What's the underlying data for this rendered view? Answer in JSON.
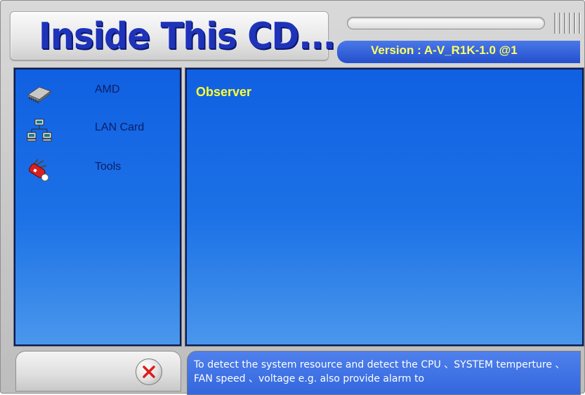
{
  "header": {
    "title": "Inside This CD...",
    "version": "Version : A-V_R1K-1.0 @1"
  },
  "sidebar": {
    "items": [
      {
        "label": "AMD",
        "icon": "chip-icon"
      },
      {
        "label": "LAN Card",
        "icon": "network-icon"
      },
      {
        "label": "Tools",
        "icon": "tools-icon"
      }
    ]
  },
  "main": {
    "title": "Observer"
  },
  "footer": {
    "exit_icon": "close-icon",
    "description": "To detect the system resource and detect the CPU 、SYSTEM temperture 、FAN speed 、voltage e.g. also provide alarm to"
  },
  "colors": {
    "panel_blue": "#1d72e6",
    "title_blue": "#1f33b8",
    "highlight_yellow": "#ffff33",
    "menu_text": "#0d1e66"
  }
}
